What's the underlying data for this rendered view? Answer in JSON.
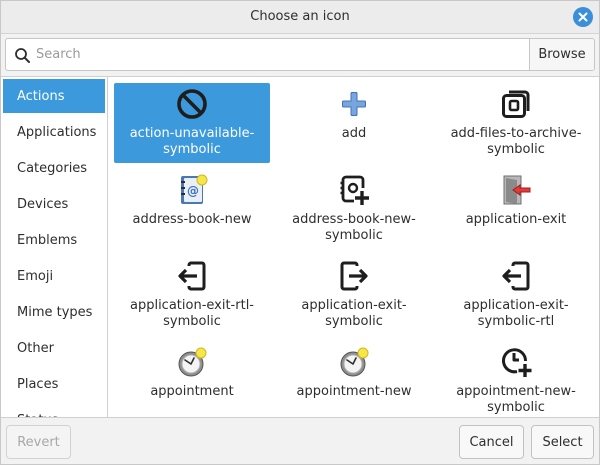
{
  "window": {
    "title": "Choose an icon"
  },
  "search": {
    "placeholder": "Search",
    "value": "",
    "browse_label": "Browse"
  },
  "categories": [
    {
      "label": "Actions",
      "selected": true
    },
    {
      "label": "Applications"
    },
    {
      "label": "Categories"
    },
    {
      "label": "Devices"
    },
    {
      "label": "Emblems"
    },
    {
      "label": "Emoji"
    },
    {
      "label": "Mime types"
    },
    {
      "label": "Other"
    },
    {
      "label": "Places"
    },
    {
      "label": "Status"
    }
  ],
  "icons": [
    {
      "label": "action-unavailable-\nsymbolic",
      "icon": "action-unavailable-icon",
      "selected": true
    },
    {
      "label": "add",
      "icon": "add-icon"
    },
    {
      "label": "add-files-to-archive-\nsymbolic",
      "icon": "add-files-to-archive-icon"
    },
    {
      "label": "address-book-new",
      "icon": "address-book-new-icon"
    },
    {
      "label": "address-book-new-\nsymbolic",
      "icon": "address-book-new-symbolic-icon"
    },
    {
      "label": "application-exit",
      "icon": "application-exit-icon"
    },
    {
      "label": "application-exit-rtl-\nsymbolic",
      "icon": "application-exit-rtl-icon"
    },
    {
      "label": "application-exit-\nsymbolic",
      "icon": "application-exit-symbolic-icon"
    },
    {
      "label": "application-exit-\nsymbolic-rtl",
      "icon": "application-exit-symbolic-rtl-icon"
    },
    {
      "label": "appointment",
      "icon": "appointment-icon"
    },
    {
      "label": "appointment-new",
      "icon": "appointment-new-icon"
    },
    {
      "label": "appointment-new-\nsymbolic",
      "icon": "appointment-new-symbolic-icon"
    }
  ],
  "footer": {
    "revert_label": "Revert",
    "cancel_label": "Cancel",
    "select_label": "Select"
  },
  "colors": {
    "accent": "#3b99dc",
    "close_button": "#3b8fd9"
  }
}
